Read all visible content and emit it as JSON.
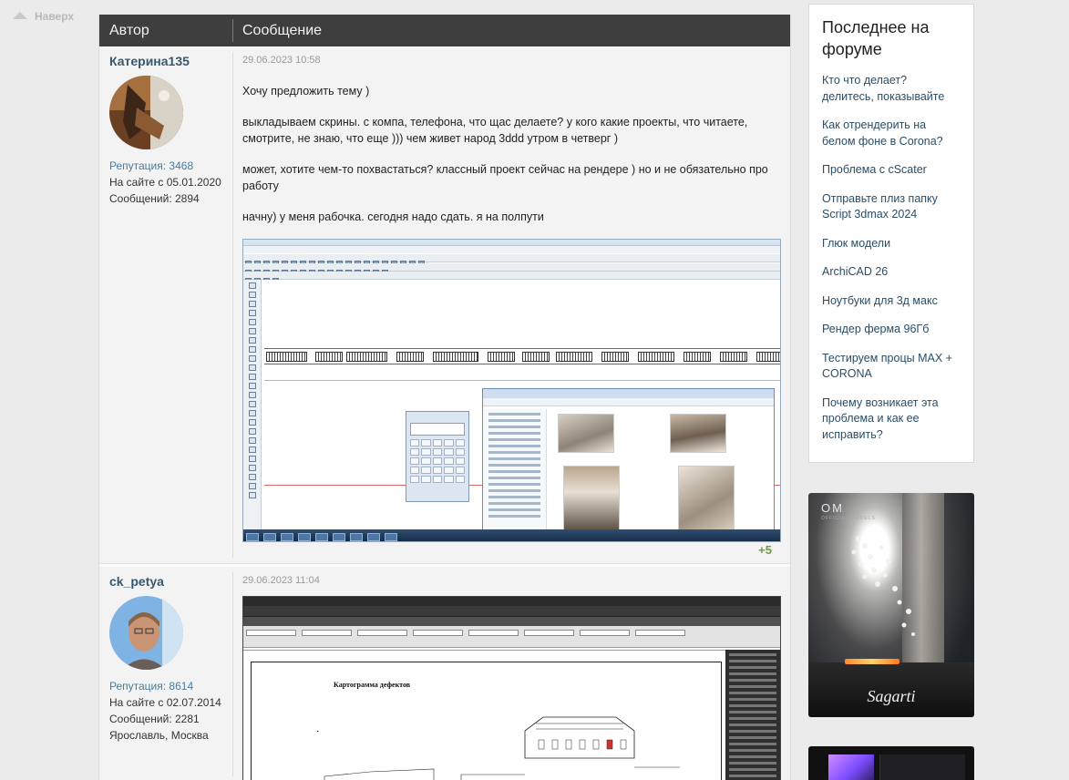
{
  "nav": {
    "to_top": "Наверх"
  },
  "thread_header": {
    "author_col": "Автор",
    "message_col": "Сообщение"
  },
  "posts": [
    {
      "author": "Катерина135",
      "reputation": "Репутация: 3468",
      "joined": "На сайте с 05.01.2020",
      "messages": "Сообщений: 2894",
      "date": "29.06.2023 10:58",
      "paragraphs": [
        "Хочу предложить тему )",
        "выкладываем скрины. с компа, телефона, что щас делаете? у кого какие проекты, что читаете, смотрите, не знаю, что еще ))) чем живет народ 3ddd утром в четверг )",
        "может, хотите чем-то похвастаться? классный проект сейчас на рендере ) но и не обязательно про работу",
        "начну) у меня рабочка. сегодня надо сдать. я на полпути"
      ],
      "likes": "+5"
    },
    {
      "author": "ck_petya",
      "reputation": "Репутация: 8614",
      "joined": "На сайте с 02.07.2014",
      "messages": "Сообщений: 2281",
      "location": "Ярославль, Москва",
      "date": "29.06.2023 11:04",
      "drawing_title": "Картограмма дефектов"
    }
  ],
  "sidebar": {
    "title": "Последнее на форуме",
    "links": [
      "Кто что делает? делитесь, показывайте",
      "Как отрендерить на белом фоне в Corona?",
      "Проблема с cScater",
      "Отправьте плиз папку Script 3dmax 2024",
      "Глюк модели",
      "ArchiCAD 26",
      "Ноутбуки для 3д макс",
      "Рендер ферма 96Гб",
      "Тестируем процы MAX + CORONA",
      "Почему возникает эта проблема и как ее исправить?"
    ]
  },
  "ads": {
    "ad1_logo": "OM",
    "ad1_sub": "OFFICIAL MODELS",
    "ad1_brand": "Sagarti"
  }
}
